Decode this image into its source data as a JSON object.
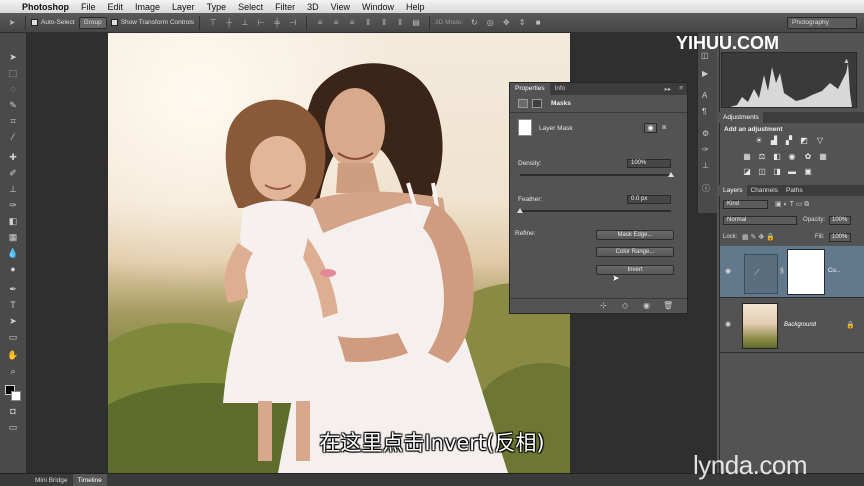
{
  "menubar": {
    "app_name": "Photoshop",
    "items": [
      "File",
      "Edit",
      "Image",
      "Layer",
      "Type",
      "Select",
      "Filter",
      "3D",
      "View",
      "Window",
      "Help"
    ]
  },
  "options": {
    "auto_select_label": "Auto-Select",
    "auto_select_mode": "Group",
    "show_transform_label": "Show Transform Controls",
    "mode_label": "3D Mode:",
    "workspace": "Photography"
  },
  "properties": {
    "tabs": [
      "Properties",
      "Info"
    ],
    "section": "Masks",
    "mask_type": "Layer Mask",
    "density_label": "Density:",
    "density_value": "100%",
    "density_fraction": 1.0,
    "feather_label": "Feather:",
    "feather_value": "0.0 px",
    "feather_fraction": 0.0,
    "refine_label": "Refine:",
    "buttons": [
      "Mask Edge...",
      "Color Range...",
      "Invert"
    ]
  },
  "adjustments": {
    "tab": "Adjustments",
    "heading": "Add an adjustment"
  },
  "layers": {
    "tabs": [
      "Layers",
      "Channels",
      "Paths"
    ],
    "kind": "Kind",
    "blend_mode": "Normal",
    "opacity_label": "Opacity:",
    "opacity_value": "100%",
    "lock_label": "Lock:",
    "fill_label": "Fill:",
    "fill_value": "100%",
    "rows": [
      {
        "name": "Cu..."
      },
      {
        "name": "Background"
      }
    ]
  },
  "bottom_tabs": [
    "Mini Bridge",
    "Timeline"
  ],
  "watermark": "YIHUU.COM",
  "lynda": "lynda.com",
  "subtitle": "在这里点击Invert(反相)",
  "colors": {
    "panel": "#535353",
    "selected_layer": "#62788c"
  }
}
